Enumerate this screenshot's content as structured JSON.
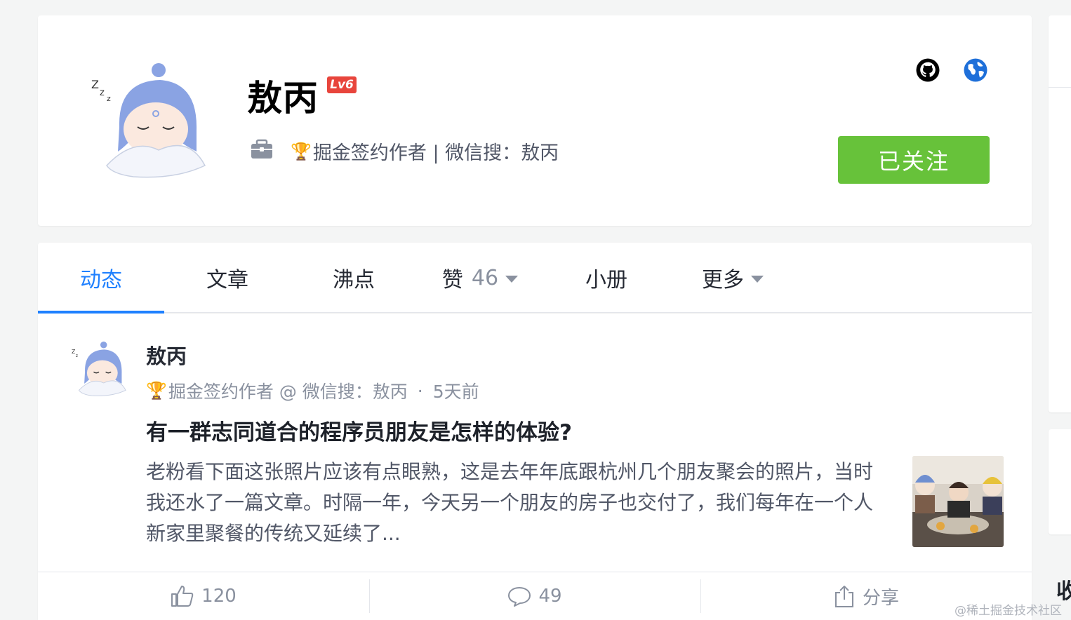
{
  "profile": {
    "username": "敖丙",
    "level": "Lv6",
    "trophy": "🏆",
    "signature": "掘金签约作者 | 微信搜：敖丙",
    "follow_label": "已关注",
    "icons": [
      "briefcase-icon",
      "github-icon",
      "globe-icon"
    ]
  },
  "tabs": [
    {
      "label": "动态",
      "active": true
    },
    {
      "label": "文章"
    },
    {
      "label": "沸点"
    },
    {
      "label": "赞",
      "count": "46"
    },
    {
      "label": "小册"
    },
    {
      "label": "更多"
    }
  ],
  "feed": {
    "author": "敖丙",
    "trophy": "🏆",
    "author_title": "掘金签约作者 @ 微信搜：敖丙",
    "dot": "·",
    "time": "5天前",
    "title": "有一群志同道合的程序员朋友是怎样的体验?",
    "excerpt": "老粉看下面这张照片应该有点眼熟，这是去年年底跟杭州几个朋友聚会的照片，当时我还水了一篇文章。时隔一年，今天另一个朋友的房子也交付了，我们每年在一个人新家里聚餐的传统又延续了...",
    "likes": "120",
    "comments": "49",
    "share_label": "分享"
  },
  "sidebar": {
    "partial_text": "收"
  },
  "watermark": "@稀土掘金技术社区",
  "colors": {
    "accent": "#1e80ff",
    "follow_green": "#67c23a",
    "level_red": "#e8453c"
  }
}
